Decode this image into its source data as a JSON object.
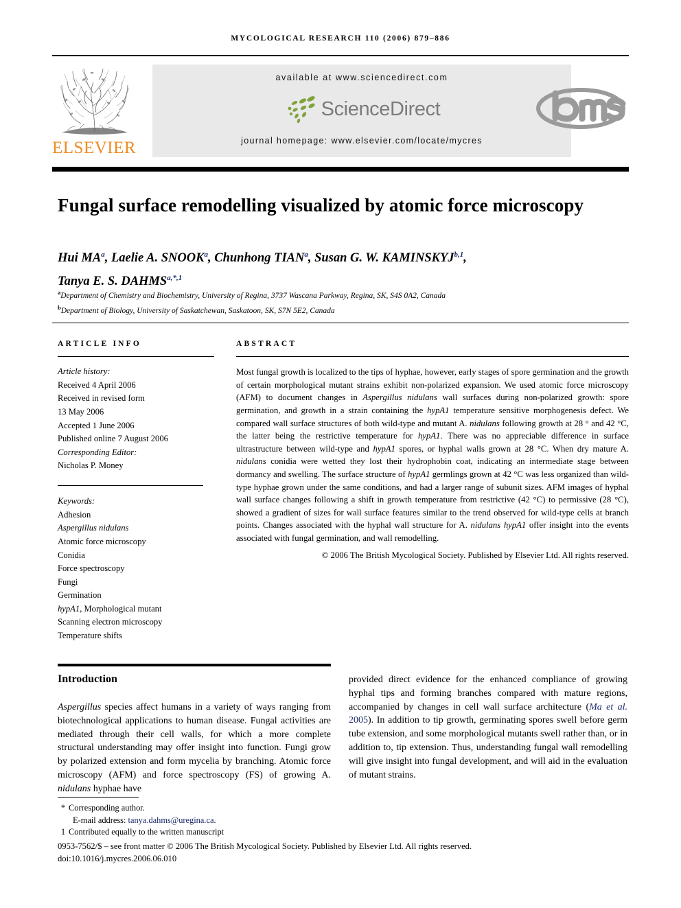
{
  "running_head": "Mycological Research 110 (2006) 879–886",
  "header": {
    "publisher_name": "ELSEVIER",
    "available_at": "available at www.sciencedirect.com",
    "sciencedirect_wordmark": "ScienceDirect",
    "journal_homepage": "journal homepage: www.elsevier.com/locate/mycres",
    "society_logo_text": "bms",
    "colors": {
      "elsevier_orange": "#ef8b22",
      "panel_grey": "#e9e9e9",
      "sciencedirect_grey": "#7b7b7b",
      "sciencedirect_green": "#80a33a",
      "bms_grey": "#9a9a9a",
      "link_blue": "#1b2a6b"
    }
  },
  "article": {
    "title": "Fungal surface remodelling visualized by atomic force microscopy",
    "authors_line_1_part1": "Hui MA",
    "authors_line_1_sup1": "a",
    "authors_line_1_part2": ", Laelie A. SNOOK",
    "authors_line_1_sup2": "a",
    "authors_line_1_part3": ", Chunhong TIAN",
    "authors_line_1_sup3": "a",
    "authors_line_1_part4": ", Susan G. W. KAMINSKYJ",
    "authors_line_1_sup4": "b,1",
    "authors_line_1_part5": ",",
    "authors_line_2_part1": "Tanya E. S. DAHMS",
    "authors_line_2_sup1": "a,*,1",
    "affiliations": [
      {
        "marker": "a",
        "text": "Department of Chemistry and Biochemistry, University of Regina, 3737 Wascana Parkway, Regina, SK, S4S 0A2, Canada"
      },
      {
        "marker": "b",
        "text": "Department of Biology, University of Saskatchewan, Saskatoon, SK, S7N 5E2, Canada"
      }
    ]
  },
  "article_info": {
    "heading": "ARTICLE INFO",
    "history_label": "Article history:",
    "history": [
      "Received 4 April 2006",
      "Received in revised form",
      "13 May 2006",
      "Accepted 1 June 2006",
      "Published online 7 August 2006"
    ],
    "editor_label": "Corresponding Editor:",
    "editor_name": "Nicholas P. Money",
    "keywords_label": "Keywords:",
    "keywords": [
      "Adhesion",
      "Aspergillus nidulans",
      "Atomic force microscopy",
      "Conidia",
      "Force spectroscopy",
      "Fungi",
      "Germination",
      "hypA1, Morphological mutant",
      "Scanning electron microscopy",
      "Temperature shifts"
    ]
  },
  "abstract": {
    "heading": "ABSTRACT",
    "text": "Most fungal growth is localized to the tips of hyphae, however, early stages of spore germination and the growth of certain morphological mutant strains exhibit non-polarized expansion. We used atomic force microscopy (AFM) to document changes in Aspergillus nidulans wall surfaces during non-polarized growth: spore germination, and growth in a strain containing the hypA1 temperature sensitive morphogenesis defect. We compared wall surface structures of both wild-type and mutant A. nidulans following growth at 28 ° and 42 °C, the latter being the restrictive temperature for hypA1. There was no appreciable difference in surface ultrastructure between wild-type and hypA1 spores, or hyphal walls grown at 28 °C. When dry mature A. nidulans conidia were wetted they lost their hydrophobin coat, indicating an intermediate stage between dormancy and swelling. The surface structure of hypA1 germlings grown at 42 °C was less organized than wild-type hyphae grown under the same conditions, and had a larger range of subunit sizes. AFM images of hyphal wall surface changes following a shift in growth temperature from restrictive (42 °C) to permissive (28 °C), showed a gradient of sizes for wall surface features similar to the trend observed for wild-type cells at branch points. Changes associated with the hyphal wall structure for A. nidulans hypA1 offer insight into the events associated with fungal germination, and wall remodelling.",
    "copyright": "© 2006 The British Mycological Society. Published by Elsevier Ltd. All rights reserved."
  },
  "introduction": {
    "heading": "Introduction",
    "left_paragraph": "Aspergillus species affect humans in a variety of ways ranging from biotechnological applications to human disease. Fungal activities are mediated through their cell walls, for which a more complete structural understanding may offer insight into function. Fungi grow by polarized extension and form mycelia by branching. Atomic force microscopy (AFM) and force spectroscopy (FS) of growing A. nidulans hyphae have",
    "right_paragraph_before_cite": "provided direct evidence for the enhanced compliance of growing hyphal tips and forming branches compared with mature regions, accompanied by changes in cell wall surface architecture (",
    "right_citation": "Ma et al. 2005",
    "right_paragraph_after_cite": "). In addition to tip growth, germinating spores swell before germ tube extension, and some morphological mutants swell rather than, or in addition to, tip extension. Thus, understanding fungal wall remodelling will give insight into fungal development, and will aid in the evaluation of mutant strains."
  },
  "footnotes": {
    "corresponding_marker": "*",
    "corresponding_text": "Corresponding author.",
    "email_label": "E-mail address:",
    "email": "tanya.dahms@uregina.ca",
    "email_trailing": ".",
    "equal_marker": "1",
    "equal_text": "Contributed equally to the written manuscript",
    "imprint": "0953-7562/$ – see front matter © 2006 The British Mycological Society. Published by Elsevier Ltd. All rights reserved.",
    "doi": "doi:10.1016/j.mycres.2006.06.010"
  }
}
